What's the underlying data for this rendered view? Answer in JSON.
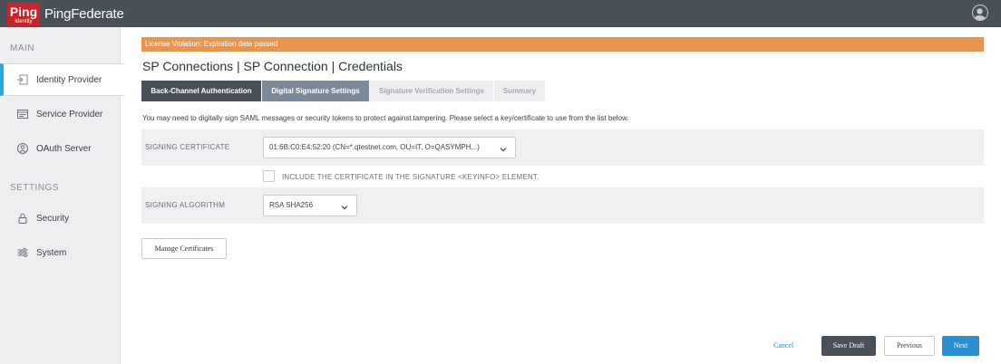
{
  "app": {
    "logo_text": "Ping",
    "logo_sub": "Identity",
    "product_name": "PingFederate"
  },
  "sidebar": {
    "sections": [
      {
        "heading": "MAIN",
        "items": [
          {
            "label": "Identity Provider",
            "icon": "identity-provider-icon",
            "active": true
          },
          {
            "label": "Service Provider",
            "icon": "service-provider-icon",
            "active": false
          },
          {
            "label": "OAuth Server",
            "icon": "oauth-server-icon",
            "active": false
          }
        ]
      },
      {
        "heading": "SETTINGS",
        "items": [
          {
            "label": "Security",
            "icon": "lock-icon",
            "active": false
          },
          {
            "label": "System",
            "icon": "sliders-icon",
            "active": false
          }
        ]
      }
    ]
  },
  "alert": {
    "text": "License Violation: Expiration date passed",
    "color": "#e8964f"
  },
  "page": {
    "title": "SP Connections | SP Connection | Credentials"
  },
  "tabs": [
    {
      "label": "Back-Channel Authentication",
      "state": "done"
    },
    {
      "label": "Digital Signature Settings",
      "state": "current"
    },
    {
      "label": "Signature Verification Settings",
      "state": "future"
    },
    {
      "label": "Summary",
      "state": "future"
    }
  ],
  "form": {
    "intro": "You may need to digitally sign SAML messages or security tokens to protect against tampering. Please select a key/certificate to use from the list below.",
    "signing_certificate": {
      "label": "SIGNING CERTIFICATE",
      "value": "01:6B:C0:E4:52:20 (CN=*.qtestnet.com, OU=IT, O=QASYMPH...)"
    },
    "include_certificate": {
      "label": "INCLUDE THE CERTIFICATE IN THE SIGNATURE <KEYINFO> ELEMENT.",
      "checked": false
    },
    "signing_algorithm": {
      "label": "SIGNING ALGORITHM",
      "value": "RSA SHA256"
    },
    "manage_certificates_label": "Manage Certificates"
  },
  "footer": {
    "cancel_label": "Cancel",
    "save_draft_label": "Save Draft",
    "previous_label": "Previous",
    "next_label": "Next"
  },
  "colors": {
    "topbar": "#4a5058",
    "accent": "#28a8e0",
    "next_button": "#2a8fd0",
    "logo_red": "#c8232b"
  }
}
